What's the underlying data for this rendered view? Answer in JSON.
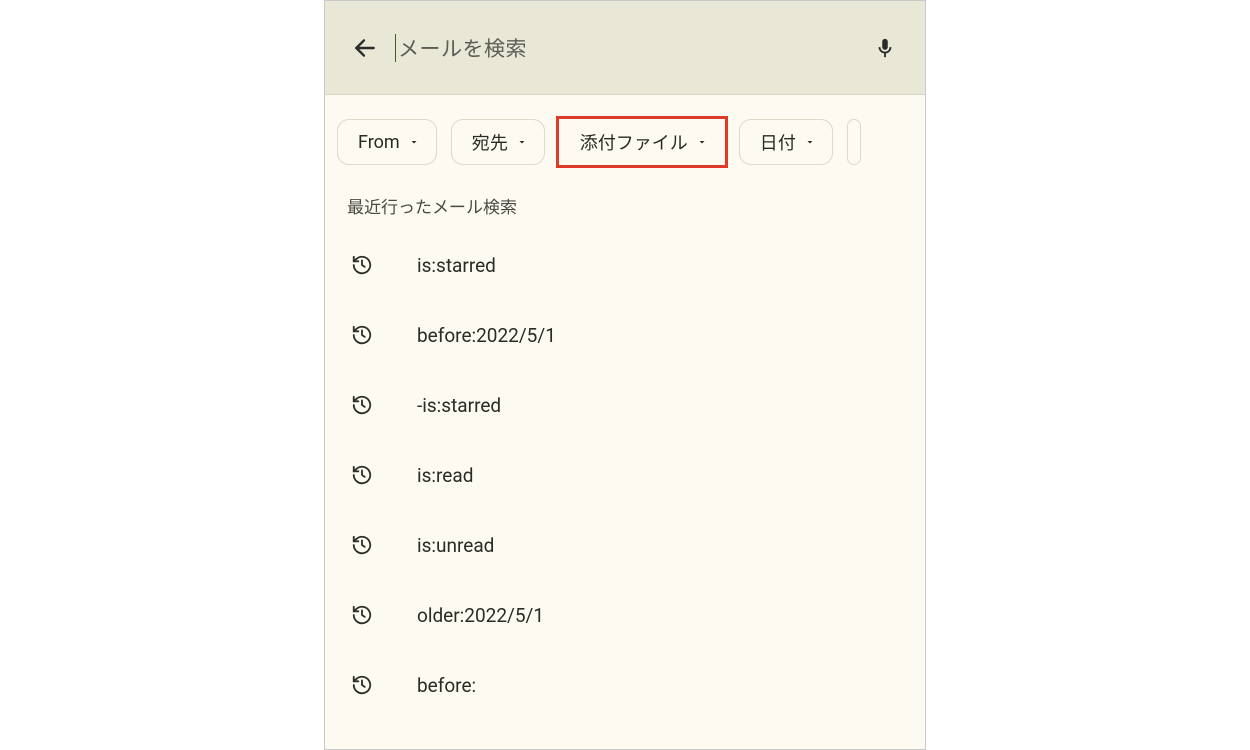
{
  "search": {
    "placeholder": "メールを検索"
  },
  "chips": [
    {
      "label": "From",
      "highlighted": false
    },
    {
      "label": "宛先",
      "highlighted": false
    },
    {
      "label": "添付ファイル",
      "highlighted": true
    },
    {
      "label": "日付",
      "highlighted": false
    }
  ],
  "section_title": "最近行ったメール検索",
  "recent": [
    {
      "query": "is:starred"
    },
    {
      "query": "before:2022/5/1"
    },
    {
      "query": "-is:starred"
    },
    {
      "query": "is:read"
    },
    {
      "query": "is:unread"
    },
    {
      "query": "older:2022/5/1"
    },
    {
      "query": "before:"
    }
  ],
  "colors": {
    "highlight": "#e03a2a",
    "header_bg": "#e9e7d6",
    "page_bg": "#fdfaf1"
  }
}
